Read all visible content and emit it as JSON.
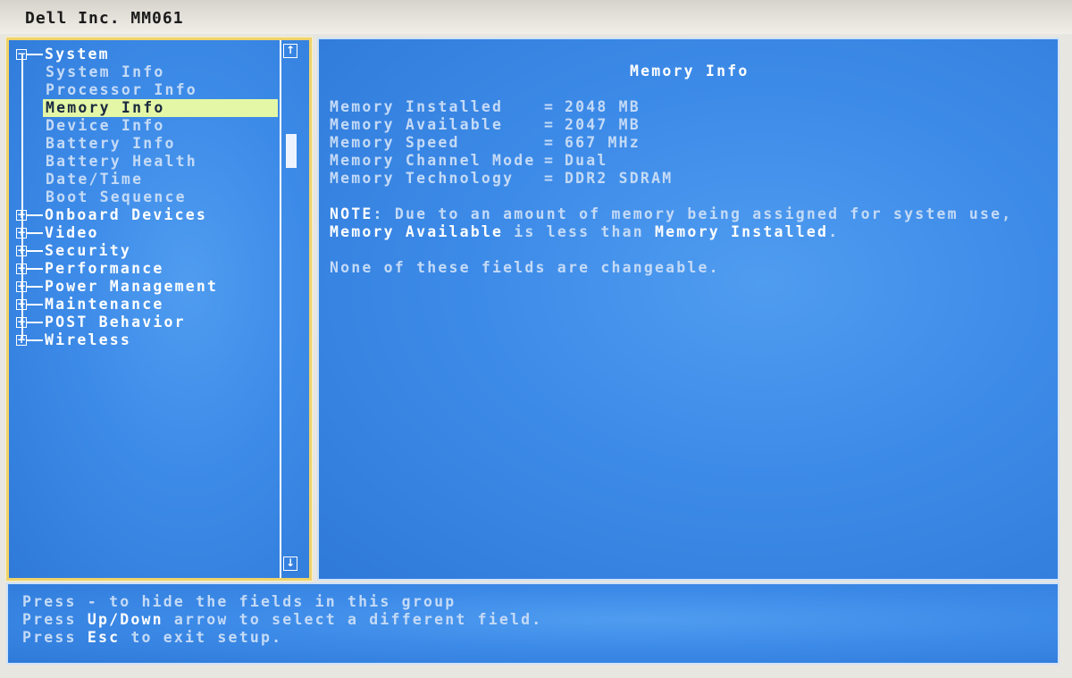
{
  "window": {
    "title": "Dell Inc. MM061"
  },
  "tree": {
    "groups": [
      {
        "label": "System",
        "expanded": true,
        "children": [
          "System Info",
          "Processor Info",
          "Memory Info",
          "Device Info",
          "Battery Info",
          "Battery Health",
          "Date/Time",
          "Boot Sequence"
        ],
        "selected_child": "Memory Info"
      },
      {
        "label": "Onboard Devices",
        "expanded": false
      },
      {
        "label": "Video",
        "expanded": false
      },
      {
        "label": "Security",
        "expanded": false
      },
      {
        "label": "Performance",
        "expanded": false
      },
      {
        "label": "Power Management",
        "expanded": false
      },
      {
        "label": "Maintenance",
        "expanded": false
      },
      {
        "label": "POST Behavior",
        "expanded": false
      },
      {
        "label": "Wireless",
        "expanded": false
      }
    ],
    "scroll_up_icon": "arrow-up-icon",
    "scroll_down_icon": "arrow-down-icon"
  },
  "detail": {
    "title": "Memory Info",
    "rows": [
      {
        "label": "Memory Installed",
        "sep": "=",
        "value": "2048 MB"
      },
      {
        "label": "Memory Available",
        "sep": "=",
        "value": "2047 MB"
      },
      {
        "label": "Memory Speed",
        "sep": "=",
        "value": "667 MHz"
      },
      {
        "label": "Memory Channel Mode",
        "sep": "=",
        "value": "Dual"
      },
      {
        "label": "Memory Technology",
        "sep": "=",
        "value": "DDR2 SDRAM"
      }
    ],
    "note": {
      "prefix": "NOTE",
      "line1": ": Due to an amount of memory being assigned for system use,",
      "line2_bold1": "Memory Available",
      "line2_mid": " is less than ",
      "line2_bold2": "Memory Installed",
      "line2_end": "."
    },
    "footer_note": "None of these fields are changeable."
  },
  "help": {
    "line1": {
      "press": "Press",
      "rest": " - to hide the fields in this group"
    },
    "line2": {
      "press": "Press",
      "key": "Up/Down",
      "rest": " arrow to select a different field."
    },
    "line3": {
      "press": "Press",
      "key": "Esc",
      "rest": " to exit setup."
    }
  },
  "colors": {
    "background": "#3d8be8",
    "highlight": "#e4f7a6",
    "border_active": "#efd36a",
    "text": "#ffffff"
  }
}
